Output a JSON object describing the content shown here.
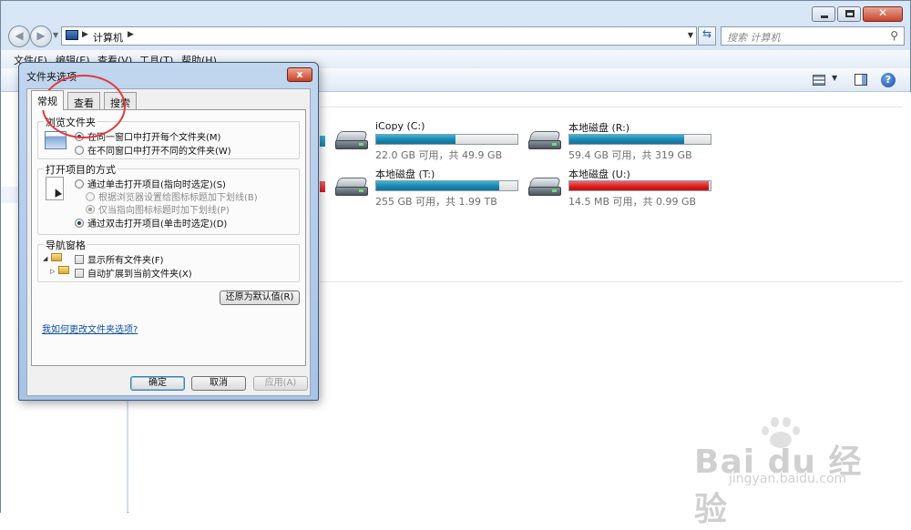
{
  "explorer": {
    "breadcrumb": "计算机",
    "search_placeholder": "搜索 计算机",
    "menu": [
      "文件(F)",
      "编辑(E)",
      "查看(V)",
      "工具(T)",
      "帮助(H)"
    ],
    "drives": [
      {
        "name": "iCopy (C:)",
        "info": "22.0 GB 可用，共 49.9 GB",
        "used_fraction": 0.56,
        "low_space": false
      },
      {
        "name": "本地磁盘 (R:)",
        "info": "59.4 GB 可用，共 319 GB",
        "used_fraction": 0.81,
        "low_space": false
      },
      {
        "name": "本地磁盘 (T:)",
        "info": "255 GB 可用，共 1.99 TB",
        "used_fraction": 0.87,
        "low_space": false
      },
      {
        "name": "本地磁盘 (U:)",
        "info": "14.5 MB 可用，共 0.99 GB",
        "used_fraction": 0.99,
        "low_space": true
      }
    ]
  },
  "dialog": {
    "title": "文件夹选项",
    "close": "x",
    "tabs": [
      "常规",
      "查看",
      "搜索"
    ],
    "browse_group": {
      "title": "浏览文件夹",
      "options": [
        "在同一窗口中打开每个文件夹(M)",
        "在不同窗口中打开不同的文件夹(W)"
      ]
    },
    "click_group": {
      "title": "打开项目的方式",
      "options": [
        "通过单击打开项目(指向时选定)(S)",
        "根据浏览器设置给图标标题加下划线(B)",
        "仅当指向图标标题时加下划线(P)",
        "通过双击打开项目(单击时选定)(D)"
      ]
    },
    "nav_group": {
      "title": "导航窗格",
      "options": [
        "显示所有文件夹(F)",
        "自动扩展到当前文件夹(X)"
      ]
    },
    "restore_button": "还原为默认值(R)",
    "help_link": "我如何更改文件夹选项?",
    "buttons": {
      "ok": "确定",
      "cancel": "取消",
      "apply": "应用(A)"
    }
  },
  "watermark": {
    "brand": "Bai du 经验",
    "url": "jingyan.baidu.com"
  }
}
